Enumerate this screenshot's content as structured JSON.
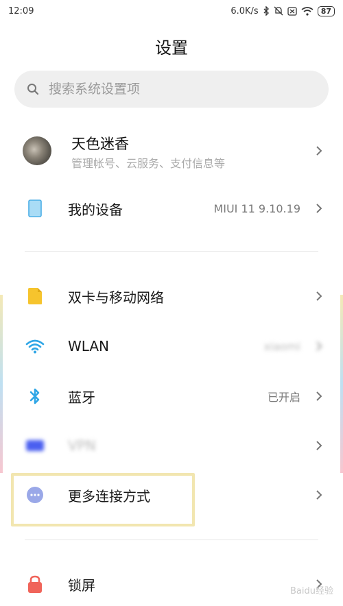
{
  "status_bar": {
    "time": "12:09",
    "net_speed": "6.0K/s",
    "battery": "87"
  },
  "page_title": "设置",
  "search": {
    "placeholder": "搜索系统设置项"
  },
  "profile": {
    "name": "天色迷香",
    "subtitle": "管理帐号、云服务、支付信息等"
  },
  "my_device": {
    "label": "我的设备",
    "value": "MIUI 11 9.10.19"
  },
  "network_items": [
    {
      "label": "双卡与移动网络",
      "value": ""
    },
    {
      "label": "WLAN",
      "value": "xiaomi"
    },
    {
      "label": "蓝牙",
      "value": "已开启"
    },
    {
      "label": "VPN",
      "value": ""
    },
    {
      "label": "更多连接方式",
      "value": ""
    }
  ],
  "lock": {
    "label": "锁屏"
  },
  "watermark": "Baidu经验",
  "colors": {
    "sim_icon": "#f6c42d",
    "wifi_icon": "#2fa6e6",
    "bluetooth_icon": "#2fa6e6",
    "vpn_icon": "#4a5ff0",
    "more_icon": "#9aa8e8",
    "lock_icon": "#f0645a",
    "device_icon": "#7cc8f0",
    "highlight": "#f2e6b0"
  },
  "icons": {
    "search": "search-icon",
    "chevron": "chevron-right-icon",
    "sim": "sim-card-icon",
    "wifi": "wifi-icon",
    "bluetooth": "bluetooth-icon",
    "vpn": "vpn-icon",
    "more": "more-connections-icon",
    "lock": "lock-icon",
    "device": "phone-device-icon"
  }
}
